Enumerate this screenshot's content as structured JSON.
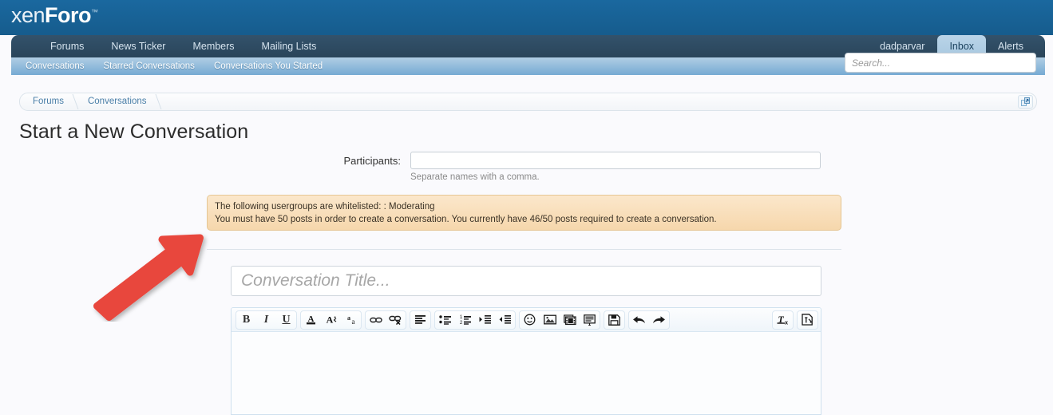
{
  "site": {
    "logo_text_1": "xen",
    "logo_text_2": "Foro",
    "logo_tm": "™"
  },
  "colors": {
    "header_blue": "#165C8D",
    "nav_dark": "#2A455A",
    "subnav_blue": "#76AAD3",
    "selected_tab": "#A8C8E0",
    "notice_bg": "#F6D7AC",
    "notice_border": "#E5C694",
    "annotation_red": "#E8473E",
    "link_blue": "#4A7FA8"
  },
  "nav": {
    "items": [
      {
        "label": "Forums"
      },
      {
        "label": "News Ticker"
      },
      {
        "label": "Members"
      },
      {
        "label": "Mailing Lists"
      }
    ],
    "user": "dadparvar",
    "tabs": [
      {
        "label": "Inbox",
        "selected": true
      },
      {
        "label": "Alerts",
        "selected": false
      }
    ]
  },
  "subnav": {
    "items": [
      {
        "label": "Conversations"
      },
      {
        "label": "Starred Conversations"
      },
      {
        "label": "Conversations You Started"
      }
    ]
  },
  "search": {
    "placeholder": "Search...",
    "value": ""
  },
  "breadcrumb": {
    "items": [
      {
        "label": "Forums"
      },
      {
        "label": "Conversations"
      }
    ],
    "jump_icon": "popup-open-icon"
  },
  "page": {
    "title": "Start a New Conversation"
  },
  "form": {
    "participants_label": "Participants:",
    "participants_value": "",
    "participants_placeholder": "",
    "participants_hint": "Separate names with a comma.",
    "title_placeholder": "Conversation Title...",
    "title_value": "",
    "editor_value": ""
  },
  "notice": {
    "line1": "The following usergroups are whitelisted: : Moderating",
    "line2": "You must have 50 posts in order to create a conversation. You currently have 46/50 posts required to create a conversation.",
    "posts_current": 46,
    "posts_required": 50
  },
  "toolbar": {
    "groups": [
      {
        "buttons": [
          {
            "name": "bold-icon",
            "label": "B"
          },
          {
            "name": "italic-icon",
            "label": "I"
          },
          {
            "name": "underline-icon",
            "label": "U"
          }
        ]
      },
      {
        "buttons": [
          {
            "name": "text-color-icon",
            "label": "A"
          },
          {
            "name": "font-size-icon",
            "label": "A"
          },
          {
            "name": "font-family-icon",
            "label": "a"
          }
        ]
      },
      {
        "buttons": [
          {
            "name": "insert-link-icon",
            "label": ""
          },
          {
            "name": "remove-link-icon",
            "label": ""
          }
        ]
      },
      {
        "buttons": [
          {
            "name": "text-align-icon",
            "label": ""
          }
        ]
      },
      {
        "buttons": [
          {
            "name": "bullet-list-icon",
            "label": ""
          },
          {
            "name": "numbered-list-icon",
            "label": ""
          },
          {
            "name": "indent-icon",
            "label": ""
          },
          {
            "name": "outdent-icon",
            "label": ""
          }
        ]
      },
      {
        "buttons": [
          {
            "name": "smilie-icon",
            "label": ""
          },
          {
            "name": "insert-image-icon",
            "label": ""
          },
          {
            "name": "insert-media-icon",
            "label": ""
          },
          {
            "name": "insert-quote-icon",
            "label": ""
          }
        ]
      },
      {
        "buttons": [
          {
            "name": "draft-save-icon",
            "label": ""
          }
        ]
      },
      {
        "buttons": [
          {
            "name": "undo-icon",
            "label": ""
          },
          {
            "name": "redo-icon",
            "label": ""
          }
        ]
      },
      {
        "buttons": [
          {
            "name": "remove-formatting-icon",
            "label": "T"
          }
        ]
      },
      {
        "buttons": [
          {
            "name": "toggle-bbcode-icon",
            "label": ""
          }
        ]
      }
    ]
  },
  "annotation": {
    "type": "arrow",
    "color": "#E8473E",
    "points_to": "notice-box"
  }
}
